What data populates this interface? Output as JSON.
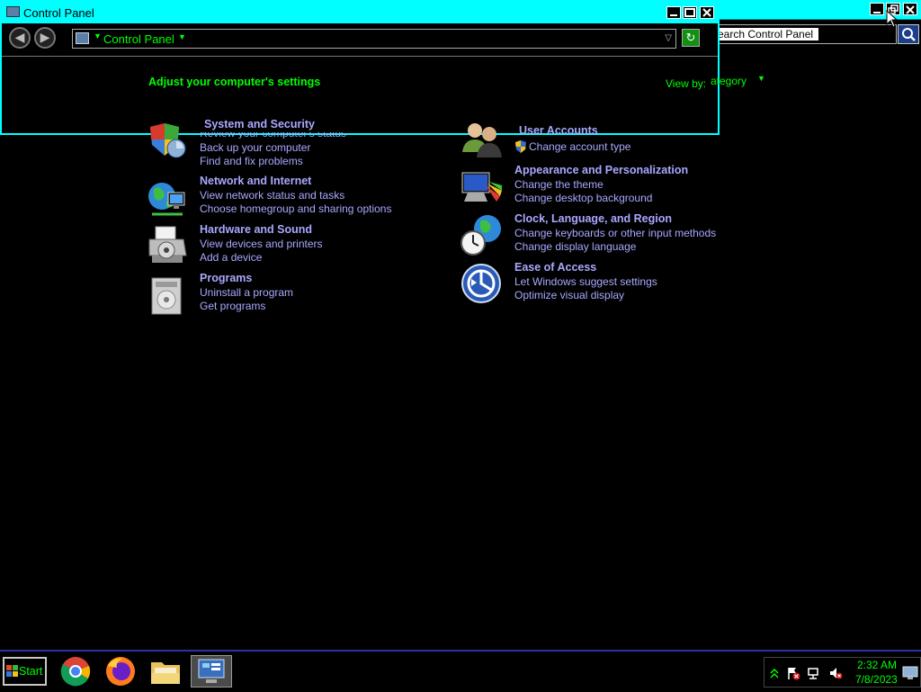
{
  "window": {
    "title": "Control Panel"
  },
  "address_bar": {
    "crumb": "Control Panel"
  },
  "search": {
    "placeholder": "Search Control Panel"
  },
  "main": {
    "heading": "Adjust your computer's settings",
    "view_by_label": "View by:",
    "view_by_value": "Category",
    "view_by_visible": "ategory"
  },
  "categories": [
    {
      "title": "System and Security",
      "links": [
        "Review your computer's status",
        "Back up your computer",
        "Find and fix problems"
      ]
    },
    {
      "title": "Network and Internet",
      "links": [
        "View network status and tasks",
        "Choose homegroup and sharing options"
      ]
    },
    {
      "title": "Hardware and Sound",
      "links": [
        "View devices and printers",
        "Add a device"
      ]
    },
    {
      "title": "Programs",
      "links": [
        "Uninstall a program",
        "Get programs"
      ]
    },
    {
      "title": "User Accounts",
      "links": [
        "Change account type"
      ]
    },
    {
      "title": "Appearance and Personalization",
      "links": [
        "Change the theme",
        "Change desktop background"
      ]
    },
    {
      "title": "Clock, Language, and Region",
      "links": [
        "Change keyboards or other input methods",
        "Change display language"
      ]
    },
    {
      "title": "Ease of Access",
      "links": [
        "Let Windows suggest settings",
        "Optimize visual display"
      ]
    }
  ],
  "taskbar": {
    "start_label": "Start",
    "apps": [
      "chrome-icon",
      "firefox-icon",
      "file-explorer-icon",
      "control-panel-icon"
    ],
    "clock_time": "2:32 AM",
    "clock_date": "7/8/2023"
  },
  "colors": {
    "title_bar": "#00ffff",
    "accent_text": "#00ff00",
    "link_text": "#a8a8ff",
    "background": "#000000"
  }
}
